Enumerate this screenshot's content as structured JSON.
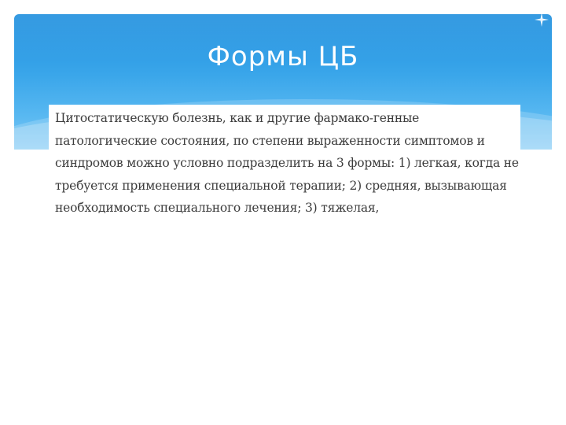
{
  "slide": {
    "title": "Формы ЦБ",
    "body": "Цитостатическую болезнь, как и другие фармако-генные патологические состояния, по степени выраженности симптомов и синдромов можно условно подразделить на 3 формы: 1) легкая, когда не требуется применения специальной терапии; 2) средняя, вызывающая необходимость специального лечения; 3) тяжелая,"
  },
  "colors": {
    "header_top": "#1f8fde",
    "header_bottom": "#7ec8f4",
    "title_text": "#ffffff",
    "body_text": "#3c3c3c"
  },
  "icons": {
    "corner": "sparkle-icon"
  }
}
